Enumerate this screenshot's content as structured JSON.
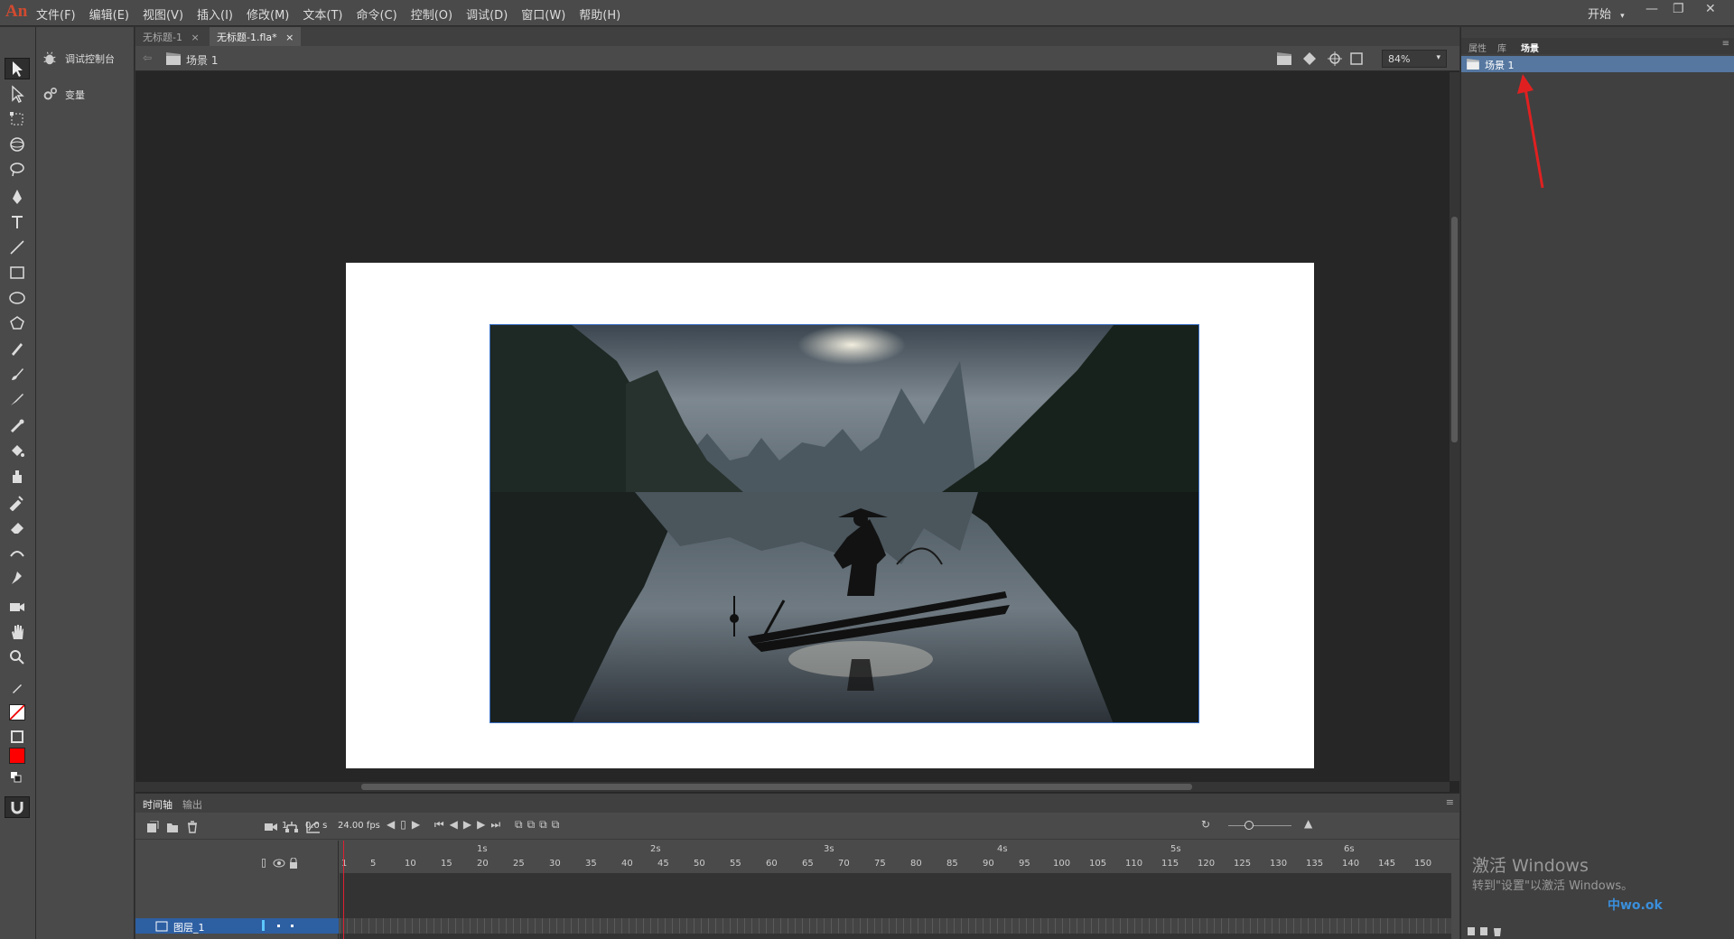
{
  "app": {
    "logo": "An"
  },
  "menu": [
    "文件(F)",
    "编辑(E)",
    "视图(V)",
    "插入(I)",
    "修改(M)",
    "文本(T)",
    "命令(C)",
    "控制(O)",
    "调试(D)",
    "窗口(W)",
    "帮助(H)"
  ],
  "workspace": {
    "label": "开始"
  },
  "window_controls": {
    "min": "—",
    "max": "❐",
    "close": "✕"
  },
  "library_panel": {
    "items": [
      {
        "label": "调试控制台",
        "icon": "bug-icon"
      },
      {
        "label": "变量",
        "icon": "gears-icon"
      }
    ]
  },
  "tabs": [
    {
      "label": "无标题-1",
      "close": "×",
      "active": false
    },
    {
      "label": "无标题-1.fla*",
      "close": "×",
      "active": true
    }
  ],
  "scene_bar": {
    "scene": "场景 1",
    "zoom": "84%"
  },
  "timeline": {
    "tabs": [
      "时间轴",
      "输出"
    ],
    "current_frame": "1",
    "time": "0.0 s",
    "fps": "24.00 fps",
    "layer_name": "图层_1",
    "seconds": [
      "1s",
      "2s",
      "3s",
      "4s",
      "5s",
      "6s"
    ],
    "frame_numbers": [
      "1",
      "5",
      "10",
      "15",
      "20",
      "25",
      "30",
      "35",
      "40",
      "45",
      "50",
      "55",
      "60",
      "65",
      "70",
      "75",
      "80",
      "85",
      "90",
      "95",
      "100",
      "105",
      "110",
      "115",
      "120",
      "125",
      "130",
      "135",
      "140",
      "145",
      "150"
    ]
  },
  "right_panel": {
    "tabs": [
      "属性",
      "库",
      "场景"
    ],
    "active_tab": "场景",
    "scene_item": "场景 1"
  },
  "watermark": {
    "line1": "激活 Windows",
    "line2": "转到\"设置\"以激活 Windows。",
    "site": "中wo.ok"
  },
  "colors": {
    "fill": "#ff0000",
    "accent": "#2d5fa3",
    "annotation_arrow": "#e02020"
  }
}
